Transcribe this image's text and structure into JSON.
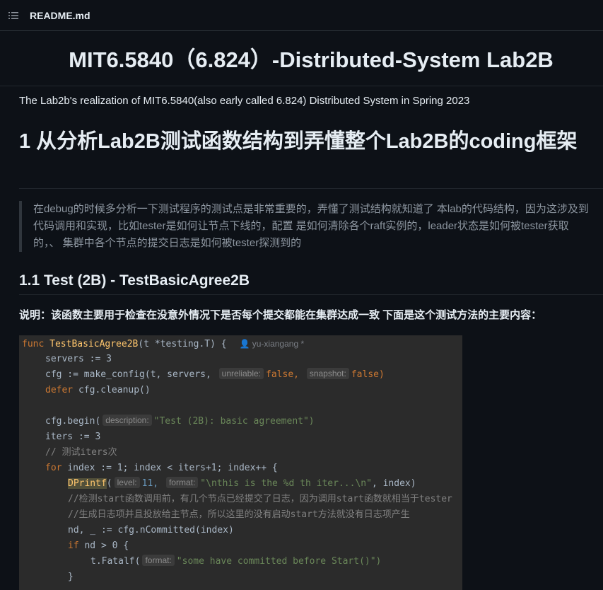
{
  "header": {
    "filename": "README.md",
    "icon": "list-icon"
  },
  "readme": {
    "title": "MIT6.5840（6.824）-Distributed-System Lab2B",
    "intro": "The Lab2b's realization of MIT6.5840(also early called 6.824) Distributed System in Spring 2023",
    "h1": "1 从分析Lab2B测试函数结构到弄懂整个Lab2B的coding框架",
    "quote": "在debug的时候多分析一下测试程序的测试点是非常重要的，弄懂了测试结构就知道了 本lab的代码结构，因为这涉及到代码调用和实现，比如tester是如何让节点下线的，配置 是如何清除各个raft实例的，leader状态是如何被tester获取的，、 集群中各个节点的提交日志是如何被tester探测到的",
    "h2": "1.1 Test (2B) - TestBasicAgree2B",
    "description": "说明：该函数主要用于检查在没意外情况下是否每个提交都能在集群达成一致 下面是这个测试方法的主要内容："
  },
  "code": {
    "author": "yu-xiangang *",
    "hints": {
      "unreliable": "unreliable:",
      "snapshot": "snapshot:",
      "description": "description:",
      "level": "level:",
      "format": "format:"
    },
    "lines": {
      "l1_kw": "func",
      "l1_fn": "TestBasicAgree2B",
      "l1_rest": "(t *testing.T) {",
      "l2": "servers := 3",
      "l3_a": "cfg := make_config(t, servers,",
      "l3_b": "false,",
      "l3_c": "false)",
      "l4_kw": "defer",
      "l4_rest": "cfg.cleanup()",
      "l6_a": "cfg.begin(",
      "l6_str": "\"Test (2B): basic agreement\")",
      "l7": "iters := 3",
      "l8": "// 测试iters次",
      "l9_kw": "for",
      "l9_rest": "index := 1; index < iters+1; index++ {",
      "l10_fn": "DPrintf",
      "l10_a": "11,",
      "l10_str": "\"\\nthis is the %d th iter...\\n\"",
      "l10_b": ", index)",
      "l11": "//检测start函数调用前，有几个节点已经提交了日志，因为调用start函数就相当于tester",
      "l12": "//生成日志项并且投放给主节点，所以这里的没有启动start方法就没有日志项产生",
      "l13": "nd, _ := cfg.nCommitted(index)",
      "l14_kw": "if",
      "l14_rest": "nd > 0 {",
      "l15_a": "t.Fatalf(",
      "l15_str": "\"some have committed before Start()\")",
      "l16": "}"
    }
  }
}
